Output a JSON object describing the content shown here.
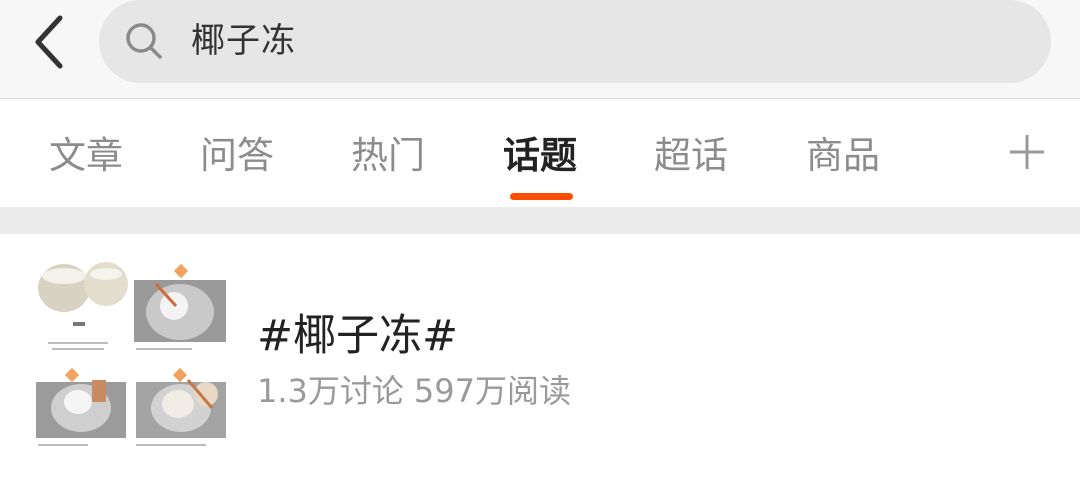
{
  "header": {
    "back_icon": "chevron-left-icon",
    "search_icon": "search-icon",
    "search_query": "椰子冻"
  },
  "tabs": {
    "items": [
      {
        "label": "文章"
      },
      {
        "label": "问答"
      },
      {
        "label": "热门"
      },
      {
        "label": "话题"
      },
      {
        "label": "超话"
      },
      {
        "label": "商品"
      }
    ],
    "active": "话题",
    "add_icon": "plus-icon",
    "accent_color": "#ff4d00"
  },
  "topic": {
    "title": "#椰子冻#",
    "discussions": "1.3万讨论",
    "reads": "597万阅读",
    "thumbnail_icon": "recipe-collage-image"
  }
}
